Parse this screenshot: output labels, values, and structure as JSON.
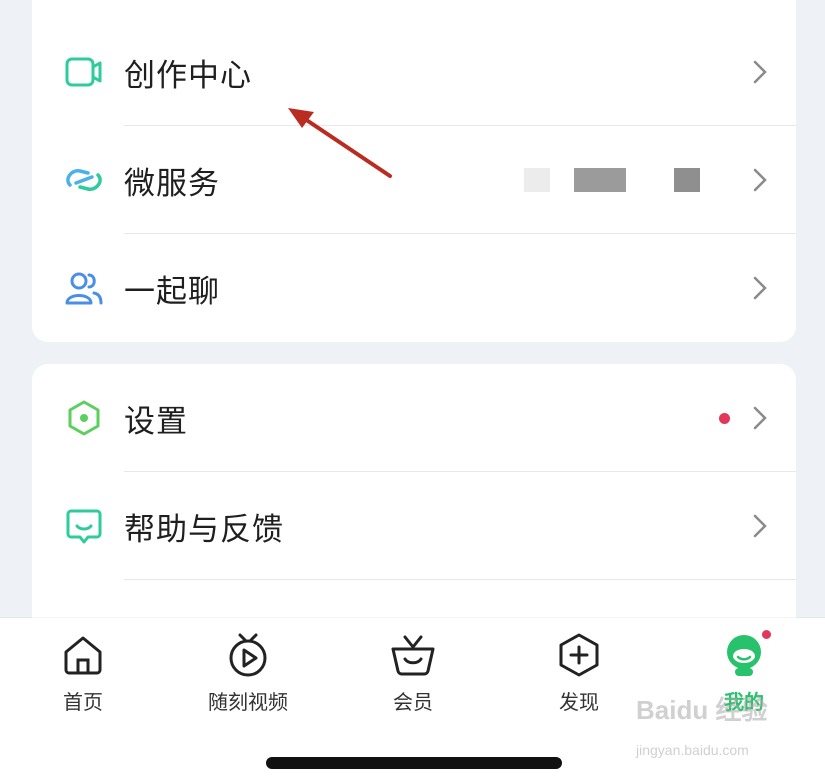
{
  "menu_group_1": {
    "items": [
      {
        "label": "创作中心",
        "icon": "video-camera-icon"
      },
      {
        "label": "微服务",
        "icon": "link-icon"
      },
      {
        "label": "一起聊",
        "icon": "users-icon"
      }
    ]
  },
  "menu_group_2": {
    "items": [
      {
        "label": "设置",
        "icon": "hexagon-settings-icon",
        "has_red_dot": true
      },
      {
        "label": "帮助与反馈",
        "icon": "feedback-icon"
      }
    ]
  },
  "tabbar": {
    "tabs": [
      {
        "label": "首页",
        "icon": "home-icon"
      },
      {
        "label": "随刻视频",
        "icon": "play-circle-icon"
      },
      {
        "label": "会员",
        "icon": "vip-basket-icon"
      },
      {
        "label": "发现",
        "icon": "plus-hexagon-icon"
      },
      {
        "label": "我的",
        "icon": "profile-avatar-icon",
        "active": true
      }
    ]
  },
  "watermark": {
    "brand": "Baidu 经验",
    "url": "jingyan.baidu.com"
  },
  "colors": {
    "accent_green": "#27c26b",
    "icon_teal": "#2ecb9b",
    "icon_blue": "#4a8ee8",
    "red_dot": "#e0375a",
    "arrow": "#b82c22"
  }
}
